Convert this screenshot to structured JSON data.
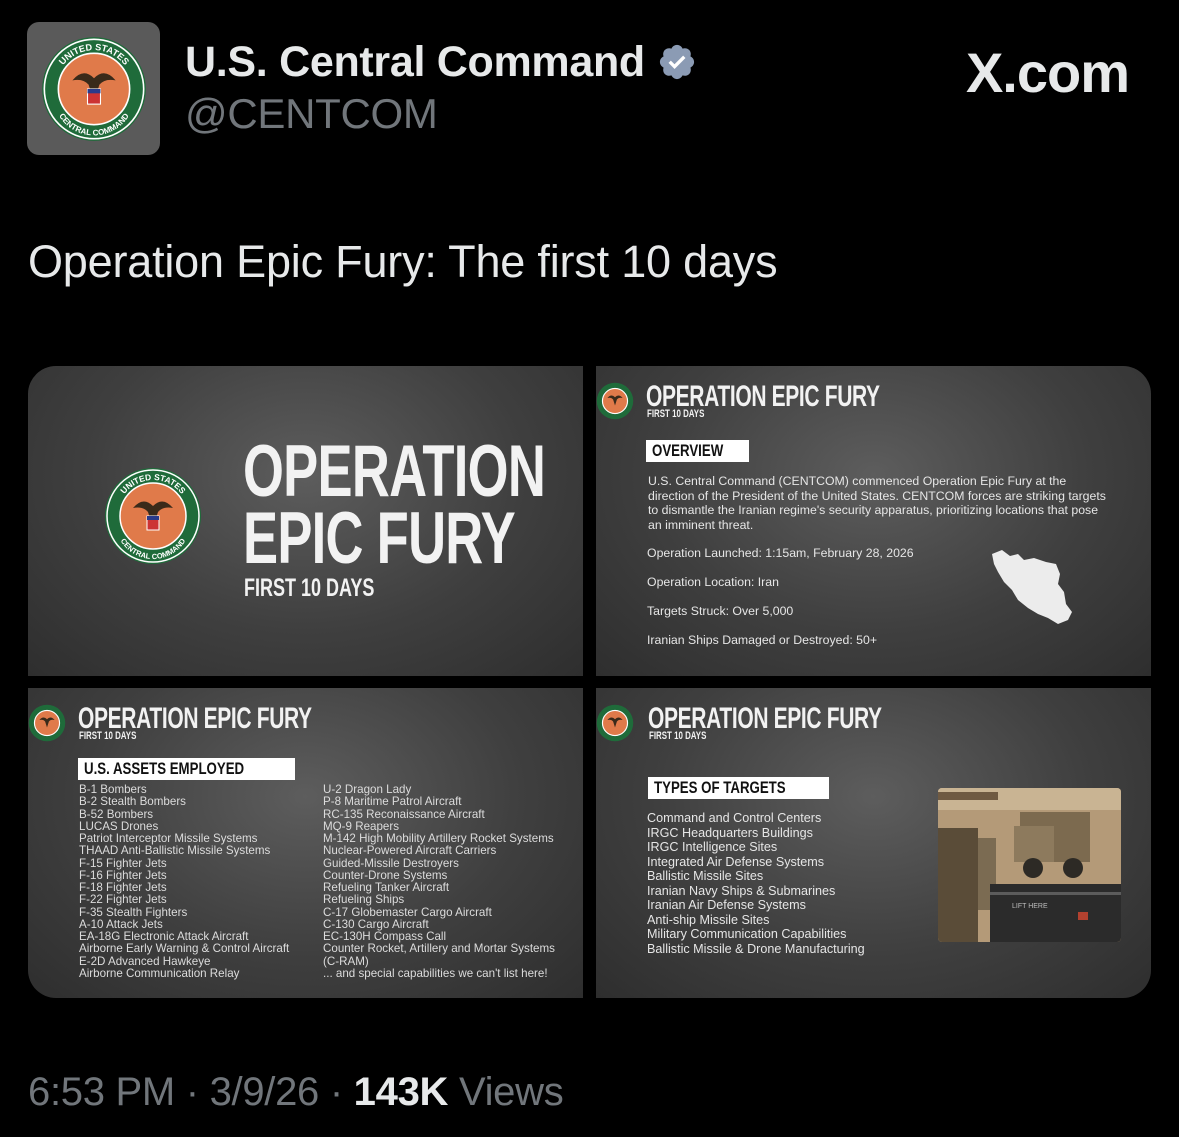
{
  "author": {
    "name": "U.S. Central Command",
    "handle": "@CENTCOM",
    "seal_text_top": "UNITED STATES",
    "seal_text_bottom": "CENTRAL COMMAND"
  },
  "brand": "X.com",
  "tweet": {
    "text": "Operation Epic Fury: The first 10 days",
    "time": "6:53 PM",
    "separator": "·",
    "date": "3/9/26",
    "views_count": "143K",
    "views_label": "Views"
  },
  "slides": {
    "title_slide": {
      "line1": "OPERATION",
      "line2": "EPIC FURY",
      "subtitle": "FIRST 10 DAYS"
    },
    "header": {
      "title": "OPERATION EPIC FURY",
      "subtitle": "FIRST 10 DAYS"
    },
    "overview": {
      "tag": "OVERVIEW",
      "body": "U.S. Central Command (CENTCOM) commenced Operation Epic Fury at the direction of the President of the United States. CENTCOM forces are striking targets to dismantle the Iranian regime's security apparatus, prioritizing locations that pose an imminent threat.",
      "stats": [
        "Operation Launched: 1:15am, February 28, 2026",
        "Operation Location: Iran",
        "Targets Struck: Over 5,000",
        "Iranian Ships Damaged or Destroyed: 50+"
      ]
    },
    "assets": {
      "tag": "U.S. ASSETS EMPLOYED",
      "col1": [
        "B-1 Bombers",
        "B-2 Stealth Bombers",
        "B-52 Bombers",
        "LUCAS Drones",
        "Patriot Interceptor Missile Systems",
        "THAAD Anti-Ballistic Missile Systems",
        "F-15 Fighter Jets",
        "F-16 Fighter Jets",
        "F-18 Fighter Jets",
        "F-22 Fighter Jets",
        "F-35 Stealth Fighters",
        "A-10 Attack Jets",
        "EA-18G Electronic Attack Aircraft",
        "Airborne Early Warning & Control Aircraft",
        "E-2D Advanced Hawkeye",
        "Airborne Communication Relay"
      ],
      "col2": [
        "U-2 Dragon Lady",
        "P-8 Maritime Patrol Aircraft",
        "RC-135 Reconaissance Aircraft",
        "MQ-9 Reapers",
        "M-142 High Mobility Artillery Rocket Systems",
        "Nuclear-Powered Aircraft Carriers",
        "Guided-Missile Destroyers",
        "Counter-Drone Systems",
        "Refueling Tanker Aircraft",
        "Refueling Ships",
        "C-17 Globemaster Cargo Aircraft",
        "C-130 Cargo Aircraft",
        "EC-130H Compass Call",
        "Counter Rocket, Artillery and Mortar Systems",
        "(C-RAM)",
        "... and special capabilities we can't list here!"
      ]
    },
    "targets": {
      "tag": "TYPES OF TARGETS",
      "items": [
        "Command and Control Centers",
        "IRGC Headquarters Buildings",
        "IRGC Intelligence Sites",
        "Integrated Air Defense Systems",
        "Ballistic Missile Sites",
        "Iranian Navy Ships & Submarines",
        "Iranian Air Defense Systems",
        "Anti-ship Missile Sites",
        "Military Communication Capabilities",
        "Ballistic Missile & Drone Manufacturing"
      ],
      "photo_marking": "LIFT HERE"
    }
  },
  "colors": {
    "background": "#000000",
    "text_primary": "#e7e9ea",
    "text_secondary": "#71767b",
    "verified": "#8b9bb4",
    "seal_green": "#1f6b3a",
    "seal_orange": "#e07a4a"
  }
}
